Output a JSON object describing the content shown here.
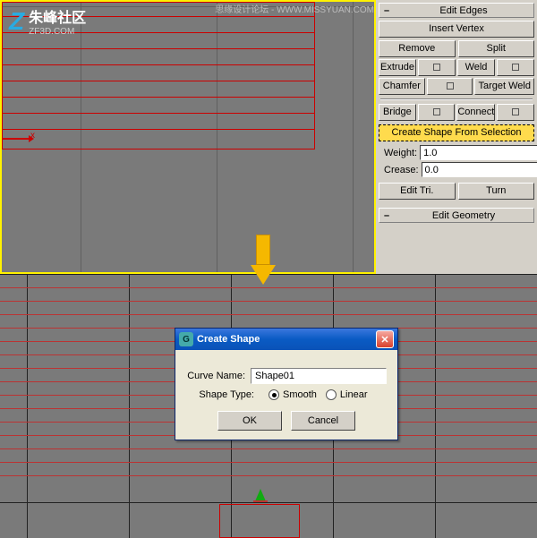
{
  "logo": {
    "cn": "朱峰社区",
    "url": "ZF3D.COM"
  },
  "top_watermark": "思缘设计论坛 - WWW.MISSYUAN.COM",
  "axis_x": "x",
  "panel": {
    "rollout_edit_edges": "Edit Edges",
    "insert_vertex": "Insert Vertex",
    "remove": "Remove",
    "split": "Split",
    "extrude": "Extrude",
    "weld": "Weld",
    "chamfer": "Chamfer",
    "target_weld": "Target Weld",
    "bridge": "Bridge",
    "connect": "Connect",
    "create_shape": "Create Shape From Selection",
    "weight_label": "Weight:",
    "weight_value": "1.0",
    "crease_label": "Crease:",
    "crease_value": "0.0",
    "edit_tri": "Edit Tri.",
    "turn": "Turn",
    "rollout_edit_geometry": "Edit Geometry"
  },
  "dialog": {
    "title": "Create Shape",
    "curve_name_label": "Curve Name:",
    "curve_name_value": "Shape01",
    "shape_type_label": "Shape Type:",
    "opt_smooth": "Smooth",
    "opt_linear": "Linear",
    "ok": "OK",
    "cancel": "Cancel"
  }
}
